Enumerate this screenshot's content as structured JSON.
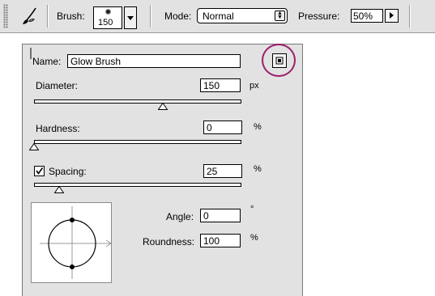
{
  "toolbar": {
    "brush_label": "Brush:",
    "brush_size": "150",
    "mode_label": "Mode:",
    "mode_value": "Normal",
    "pressure_label": "Pressure:",
    "pressure_value": "50%"
  },
  "panel": {
    "name_label": "Name:",
    "name_value": "Glow Brush",
    "diameter_label": "Diameter:",
    "diameter_value": "150",
    "diameter_unit": "px",
    "hardness_label": "Hardness:",
    "hardness_value": "0",
    "hardness_unit": "%",
    "spacing_label": "Spacing:",
    "spacing_checked": true,
    "spacing_value": "25",
    "spacing_unit": "%",
    "angle_label": "Angle:",
    "angle_value": "0",
    "angle_unit": "°",
    "roundness_label": "Roundness:",
    "roundness_value": "100",
    "roundness_unit": "%"
  },
  "sliders": {
    "diameter_level": 0.62,
    "hardness_level": 0.0,
    "spacing_level": 0.12
  },
  "icons": {
    "tool": "brush-tool-icon",
    "new_preset": "new-brush-preset-icon",
    "dropdown": "triangle-down-icon",
    "stepper": "up-down-stepper-icon",
    "pressure_arrow": "triangle-right-icon"
  },
  "colors": {
    "highlight_ring": "#9b1f6b",
    "panel_bg": "#e2e2e2"
  }
}
